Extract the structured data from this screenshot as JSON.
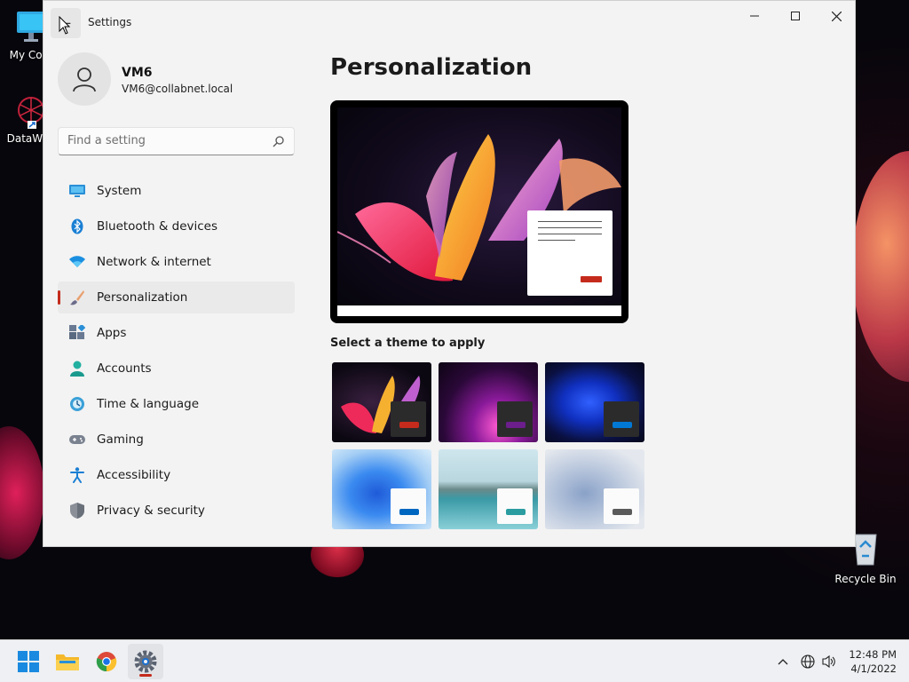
{
  "desktop": {
    "icons": [
      {
        "label": "My Com"
      },
      {
        "label": "DataWag"
      },
      {
        "label": "Recycle Bin"
      }
    ]
  },
  "window": {
    "title": "Settings",
    "profile": {
      "name": "VM6",
      "email": "VM6@collabnet.local"
    },
    "search": {
      "placeholder": "Find a setting"
    },
    "nav": [
      {
        "label": "System",
        "icon": "monitor-icon"
      },
      {
        "label": "Bluetooth & devices",
        "icon": "bluetooth-icon"
      },
      {
        "label": "Network & internet",
        "icon": "wifi-icon"
      },
      {
        "label": "Personalization",
        "icon": "brush-icon",
        "active": true
      },
      {
        "label": "Apps",
        "icon": "apps-icon"
      },
      {
        "label": "Accounts",
        "icon": "person-icon"
      },
      {
        "label": "Time & language",
        "icon": "globe-clock-icon"
      },
      {
        "label": "Gaming",
        "icon": "gamepad-icon"
      },
      {
        "label": "Accessibility",
        "icon": "accessibility-icon"
      },
      {
        "label": "Privacy & security",
        "icon": "shield-icon"
      }
    ],
    "content": {
      "page_title": "Personalization",
      "theme_section_label": "Select a theme to apply",
      "themes": [
        {
          "name": "glow-dark",
          "accent": "#c42b1c"
        },
        {
          "name": "flow-purple",
          "accent": "#6b1e8c"
        },
        {
          "name": "bloom-dark",
          "accent": "#0078d4"
        },
        {
          "name": "bloom-light",
          "accent": "#0067c0"
        },
        {
          "name": "captured-motion",
          "accent": "#2b9da0"
        },
        {
          "name": "sunrise",
          "accent": "#5a5a5a"
        }
      ]
    }
  },
  "taskbar": {
    "time": "12:48 PM",
    "date": "4/1/2022"
  },
  "colors": {
    "accent": "#c42b1c",
    "window_bg": "#f3f3f3",
    "taskbar_bg": "#eef0f3"
  }
}
